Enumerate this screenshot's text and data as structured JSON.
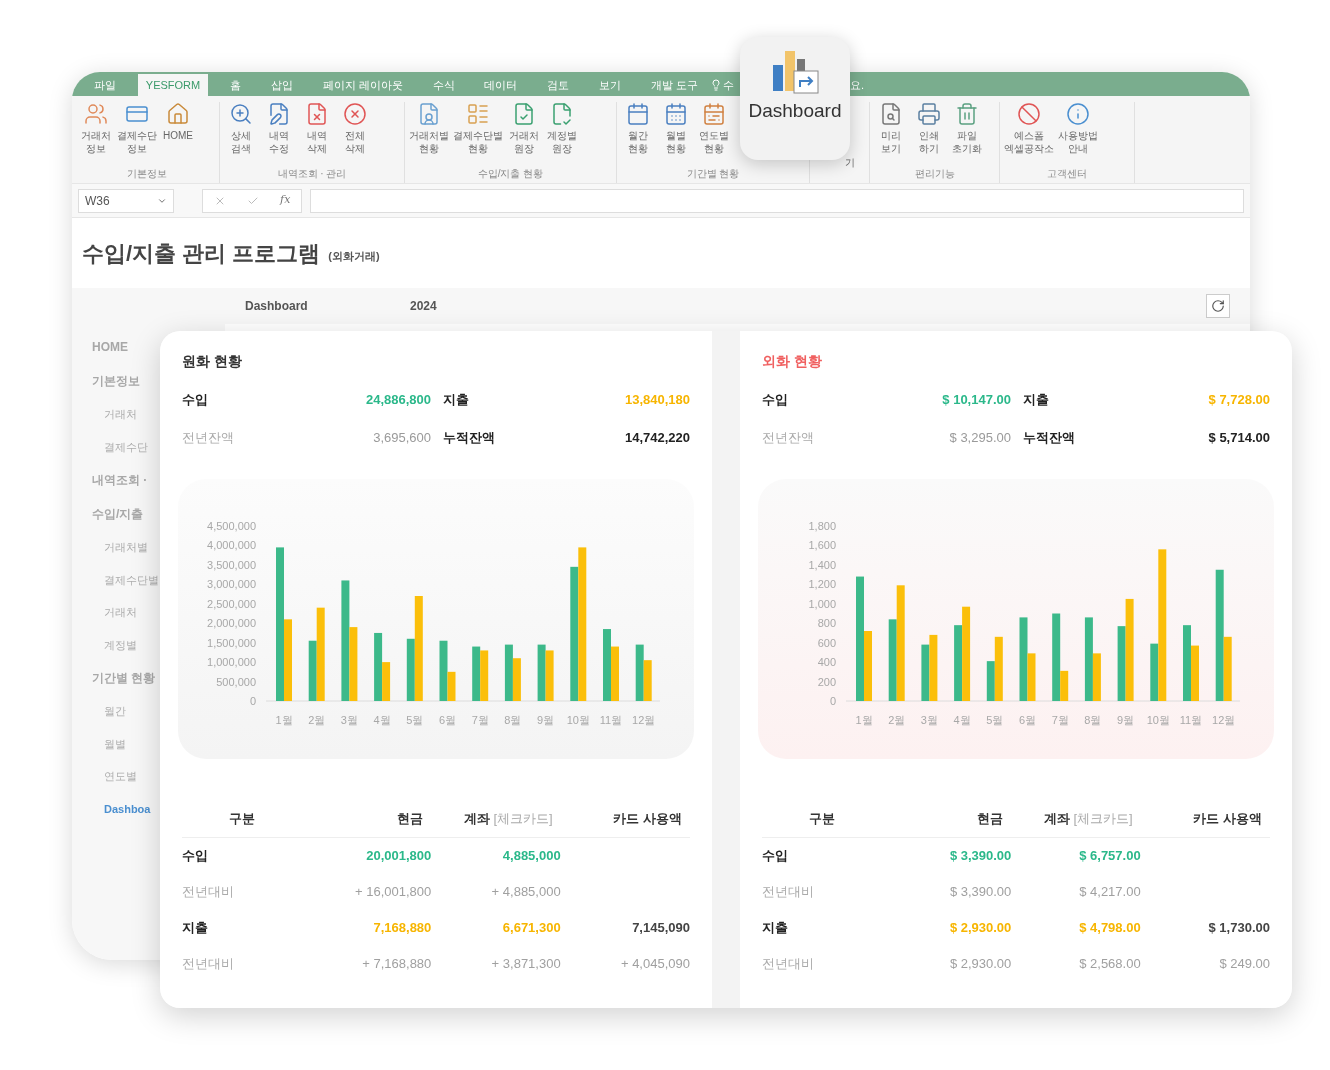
{
  "popup": {
    "label": "Dashboard"
  },
  "tabs": [
    {
      "label": "파일",
      "selected": false
    },
    {
      "label": "YESFORM",
      "selected": true
    },
    {
      "label": "홈",
      "selected": false
    },
    {
      "label": "삽입",
      "selected": false
    },
    {
      "label": "페이지 레이아웃",
      "selected": false
    },
    {
      "label": "수식",
      "selected": false
    },
    {
      "label": "데이터",
      "selected": false
    },
    {
      "label": "검토",
      "selected": false
    },
    {
      "label": "보기",
      "selected": false
    },
    {
      "label": "개발 도구",
      "selected": false
    }
  ],
  "tell_me": [
    "수",
    "요."
  ],
  "ribbon_groups": [
    {
      "label": "기본정보",
      "buttons": [
        "거래처\n정보",
        "결제수단\n정보",
        "HOME"
      ]
    },
    {
      "label": "내역조회 · 관리",
      "buttons": [
        "상세\n검색",
        "내역\n수정",
        "내역\n삭제",
        "전체\n삭제"
      ]
    },
    {
      "label": "수입/지출 현황",
      "buttons": [
        "거래처별\n현황",
        "결제수단별\n현황",
        "거래처\n원장",
        "계정별\n원장"
      ]
    },
    {
      "label": "기간별 현황",
      "buttons": [
        "월간\n현황",
        "월별\n현황",
        "연도별\n현황"
      ]
    },
    {
      "buttons": [
        "기"
      ]
    },
    {
      "label": "편리기능",
      "buttons": [
        "미리\n보기",
        "인쇄\n하기",
        "파일\n초기화"
      ]
    },
    {
      "label": "고객센터",
      "buttons": [
        "예스폼\n엑셀공작소",
        "사용방법\n안내"
      ]
    }
  ],
  "name_box": "W36",
  "fx_label": "fx",
  "title": "수입/지출 관리 프로그램",
  "subtitle": "(외화거래)",
  "header": {
    "page": "Dashboard",
    "year": "2024"
  },
  "sidebar": [
    {
      "label": "HOME",
      "selected": false
    },
    {
      "label": "기본정보",
      "selected": false,
      "children": [
        {
          "label": "거래처",
          "selected": false
        },
        {
          "label": "결제수단",
          "selected": false
        }
      ]
    },
    {
      "label": "내역조회 ·",
      "selected": false
    },
    {
      "label": "수입/지출",
      "selected": false,
      "children": [
        {
          "label": "거래처별",
          "selected": false
        },
        {
          "label": "결제수단별",
          "selected": false
        },
        {
          "label": "거래처",
          "selected": false
        },
        {
          "label": "계정별",
          "selected": false
        }
      ]
    },
    {
      "label": "기간별 현황",
      "selected": false,
      "children": [
        {
          "label": "월간",
          "selected": false
        },
        {
          "label": "월별",
          "selected": false
        },
        {
          "label": "연도별",
          "selected": false
        },
        {
          "label": "Dashboa",
          "selected": true
        }
      ]
    }
  ],
  "panels": [
    {
      "title": "원화 현황",
      "kind": "domestic",
      "summary": [
        {
          "label": "수입",
          "value": "24,886,800",
          "kind": "income"
        },
        {
          "label": "지출",
          "value": "13,840,180",
          "kind": "expense"
        },
        {
          "label": "전년잔액",
          "value": "3,695,600",
          "kind": "prior"
        },
        {
          "label": "누적잔액",
          "value": "14,742,220",
          "kind": "balance"
        }
      ],
      "chart_data": {
        "type": "bar",
        "categories": [
          "1월",
          "2월",
          "3월",
          "4월",
          "5월",
          "6월",
          "7월",
          "8월",
          "9월",
          "10월",
          "11월",
          "12월"
        ],
        "ylim": [
          0,
          4500000
        ],
        "yticks": [
          {
            "value": 0,
            "label": "0"
          },
          {
            "value": 500000,
            "label": "500,000"
          },
          {
            "value": 1000000,
            "label": "1,000,000"
          },
          {
            "value": 1500000,
            "label": "1,500,000"
          },
          {
            "value": 2000000,
            "label": "2,000,000"
          },
          {
            "value": 2500000,
            "label": "2,500,000"
          },
          {
            "value": 3000000,
            "label": "3,000,000"
          },
          {
            "value": 3500000,
            "label": "3,500,000"
          },
          {
            "value": 4000000,
            "label": "4,000,000"
          },
          {
            "value": 4500000,
            "label": "4,500,000"
          }
        ],
        "series": [
          {
            "color": "#3cb98a",
            "values": [
              3950000,
              1550000,
              3100000,
              1750000,
              1600000,
              1550000,
              1400000,
              1450000,
              1450000,
              3450000,
              1850000,
              1450000
            ]
          },
          {
            "color": "#fbbf0a",
            "values": [
              2100000,
              2400000,
              1900000,
              1000000,
              2700000,
              750000,
              1300000,
              1100000,
              1300000,
              3950000,
              1400000,
              1050000
            ]
          }
        ]
      },
      "columns": [
        {
          "label": "구분"
        },
        {
          "label": "현금"
        },
        {
          "label": "계좌",
          "note": "[체크카드]"
        },
        {
          "label": "카드 사용액"
        }
      ],
      "rows": [
        {
          "kind": "income",
          "cells": [
            "수입",
            "20,001,800",
            "4,885,000"
          ]
        },
        {
          "kind": "compare",
          "cells": [
            "전년대비",
            "+ 16,001,800",
            "+ 4,885,000"
          ]
        },
        {
          "kind": "expense",
          "cells": [
            "지출",
            "7,168,880",
            "6,671,300",
            "7,145,090"
          ]
        },
        {
          "kind": "compare",
          "cells": [
            "전년대비",
            "+ 7,168,880",
            "+ 3,871,300",
            "+ 4,045,090"
          ]
        }
      ]
    },
    {
      "title": "외화 현황",
      "kind": "foreign",
      "summary": [
        {
          "label": "수입",
          "value": "$ 10,147.00",
          "kind": "income"
        },
        {
          "label": "지출",
          "value": "$ 7,728.00",
          "kind": "expense"
        },
        {
          "label": "전년잔액",
          "value": "$ 3,295.00",
          "kind": "prior"
        },
        {
          "label": "누적잔액",
          "value": "$ 5,714.00",
          "kind": "balance"
        }
      ],
      "chart_data": {
        "type": "bar",
        "categories": [
          "1월",
          "2월",
          "3월",
          "4월",
          "5월",
          "6월",
          "7월",
          "8월",
          "9월",
          "10월",
          "11월",
          "12월"
        ],
        "ylim": [
          0,
          1800
        ],
        "yticks": [
          {
            "value": 0,
            "label": "0"
          },
          {
            "value": 200,
            "label": "200"
          },
          {
            "value": 400,
            "label": "400"
          },
          {
            "value": 600,
            "label": "600"
          },
          {
            "value": 800,
            "label": "800"
          },
          {
            "value": 1000,
            "label": "1,000"
          },
          {
            "value": 1200,
            "label": "1,200"
          },
          {
            "value": 1400,
            "label": "1,400"
          },
          {
            "value": 1600,
            "label": "1,600"
          },
          {
            "value": 1800,
            "label": "1,800"
          }
        ],
        "series": [
          {
            "color": "#3cb98a",
            "values": [
              1280,
              840,
              580,
              780,
              410,
              860,
              900,
              860,
              770,
              590,
              780,
              1350
            ]
          },
          {
            "color": "#fbbf0a",
            "values": [
              720,
              1190,
              680,
              970,
              660,
              490,
              310,
              490,
              1050,
              1560,
              570,
              660
            ]
          }
        ]
      },
      "columns": [
        {
          "label": "구분"
        },
        {
          "label": "현금"
        },
        {
          "label": "계좌",
          "note": "[체크카드]"
        },
        {
          "label": "카드 사용액"
        }
      ],
      "rows": [
        {
          "kind": "income",
          "cells": [
            "수입",
            "$ 3,390.00",
            "$ 6,757.00"
          ]
        },
        {
          "kind": "compare",
          "cells": [
            "전년대비",
            "$ 3,390.00",
            "$ 4,217.00"
          ]
        },
        {
          "kind": "expense",
          "cells": [
            "지출",
            "$ 2,930.00",
            "$ 4,798.00",
            "$ 1,730.00"
          ]
        },
        {
          "kind": "compare",
          "cells": [
            "전년대비",
            "$ 2,930.00",
            "$ 2,568.00",
            "$ 249.00"
          ]
        }
      ]
    }
  ]
}
